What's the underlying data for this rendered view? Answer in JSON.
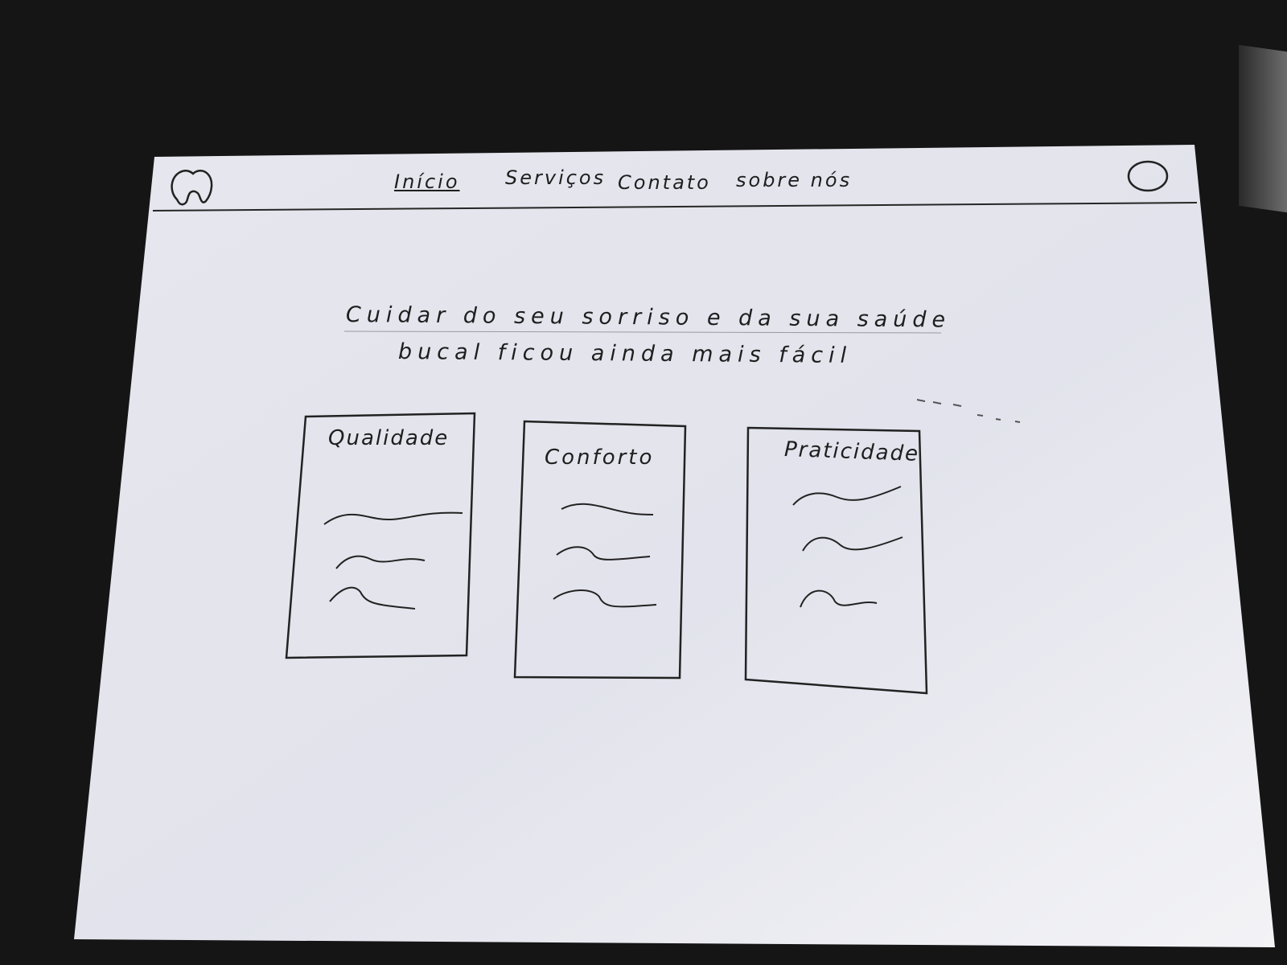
{
  "nav": {
    "items": [
      {
        "label": "Início"
      },
      {
        "label": "Serviços"
      },
      {
        "label": "Contato"
      },
      {
        "label": "sobre nós"
      }
    ]
  },
  "icons": {
    "logo": "tooth-icon",
    "profile": "user-circle-icon"
  },
  "hero": {
    "line1": "Cuidar do seu sorriso e da sua saúde",
    "line2": "bucal ficou ainda mais fácil"
  },
  "cards": [
    {
      "title": "Qualidade"
    },
    {
      "title": "Conforto"
    },
    {
      "title": "Praticidade"
    }
  ],
  "colors": {
    "paper": "#e9e9ef",
    "ink": "#1e1e1e",
    "background": "#151515"
  }
}
